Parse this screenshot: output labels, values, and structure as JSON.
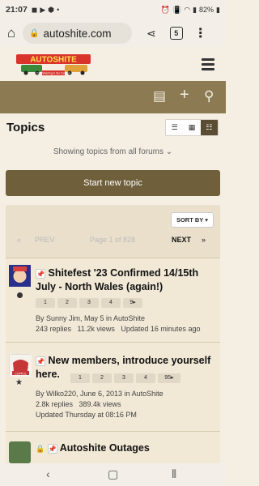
{
  "status": {
    "time": "21:07",
    "battery": "82%"
  },
  "browser": {
    "url": "autoshite.com",
    "tab_count": "5"
  },
  "header": {
    "logo_text": "AUTOSHITE",
    "logo_tagline": "Your Motoring Is Our Concern"
  },
  "page": {
    "title": "Topics",
    "showing": "Showing topics from all forums",
    "new_topic": "Start new topic",
    "sort_by": "SORT BY",
    "prev": "PREV",
    "page_info": "Page 1 of 828",
    "next": "NEXT"
  },
  "topics": [
    {
      "title": "Shitefest '23 Confirmed 14/15th July - North Wales (again!)",
      "pages": [
        "1",
        "2",
        "3",
        "4",
        "9"
      ],
      "byline": "By Sunny Jim, May 5 in AutoShite",
      "stats": "243 replies   11.2k views   Updated 16 minutes ago",
      "avatar_color": "#2a2f8a"
    },
    {
      "title": "New members, introduce yourself here.",
      "pages": [
        "1",
        "2",
        "3",
        "4",
        "95"
      ],
      "byline": "By Wilko220, June 6, 2013 in AutoShite",
      "stats": "2.8k replies   389.4k views",
      "updated": "Updated Thursday at 08:16 PM",
      "avatar_color": "#c53636",
      "avatar_text": "CUPPLE"
    },
    {
      "title": "Autoshite Outages",
      "avatar_color": "#5a7a4a"
    }
  ]
}
